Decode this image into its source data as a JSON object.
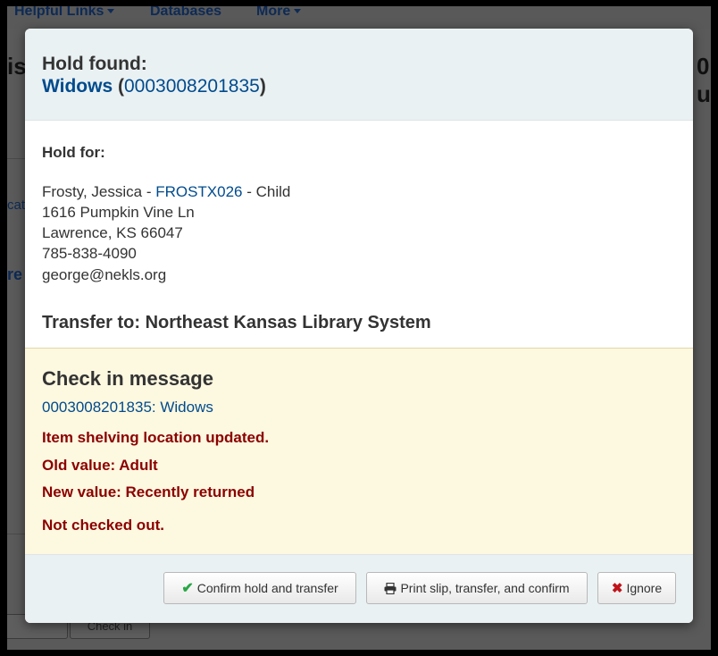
{
  "background": {
    "nav": [
      "Helpful Links",
      "Databases",
      "More"
    ],
    "check_in_button": "Check in"
  },
  "modal": {
    "header": {
      "hold_found": "Hold found:",
      "title_link": "Widows",
      "barcode": "0003008201835",
      "open_paren": "(",
      "close_paren": ")"
    },
    "body": {
      "hold_for": "Hold for:",
      "patron_name": "Frosty, Jessica - ",
      "patron_cardnumber": "FROSTX026",
      "patron_category": " - Child",
      "address1": "1616 Pumpkin Vine Ln",
      "address2": "Lawrence, KS 66047",
      "phone": "785-838-4090",
      "email": "george@nekls.org",
      "transfer_to": "Transfer to: Northeast Kansas Library System"
    },
    "message": {
      "title": "Check in message",
      "item_link": "0003008201835: Widows",
      "line1": "Item shelving location updated.",
      "line2": "Old value: Adult",
      "line3": "New value: Recently returned",
      "line4": "Not checked out."
    },
    "footer": {
      "confirm": "Confirm hold and transfer",
      "print": "Print slip, transfer, and confirm",
      "ignore": "Ignore"
    }
  },
  "colors": {
    "link": "#004b8d",
    "error": "#8b0000",
    "header_bg": "#eaf1f3",
    "message_bg": "#fdf8e0"
  },
  "icons": {
    "confirm": "check-icon",
    "print": "print-icon",
    "ignore": "close-icon"
  }
}
